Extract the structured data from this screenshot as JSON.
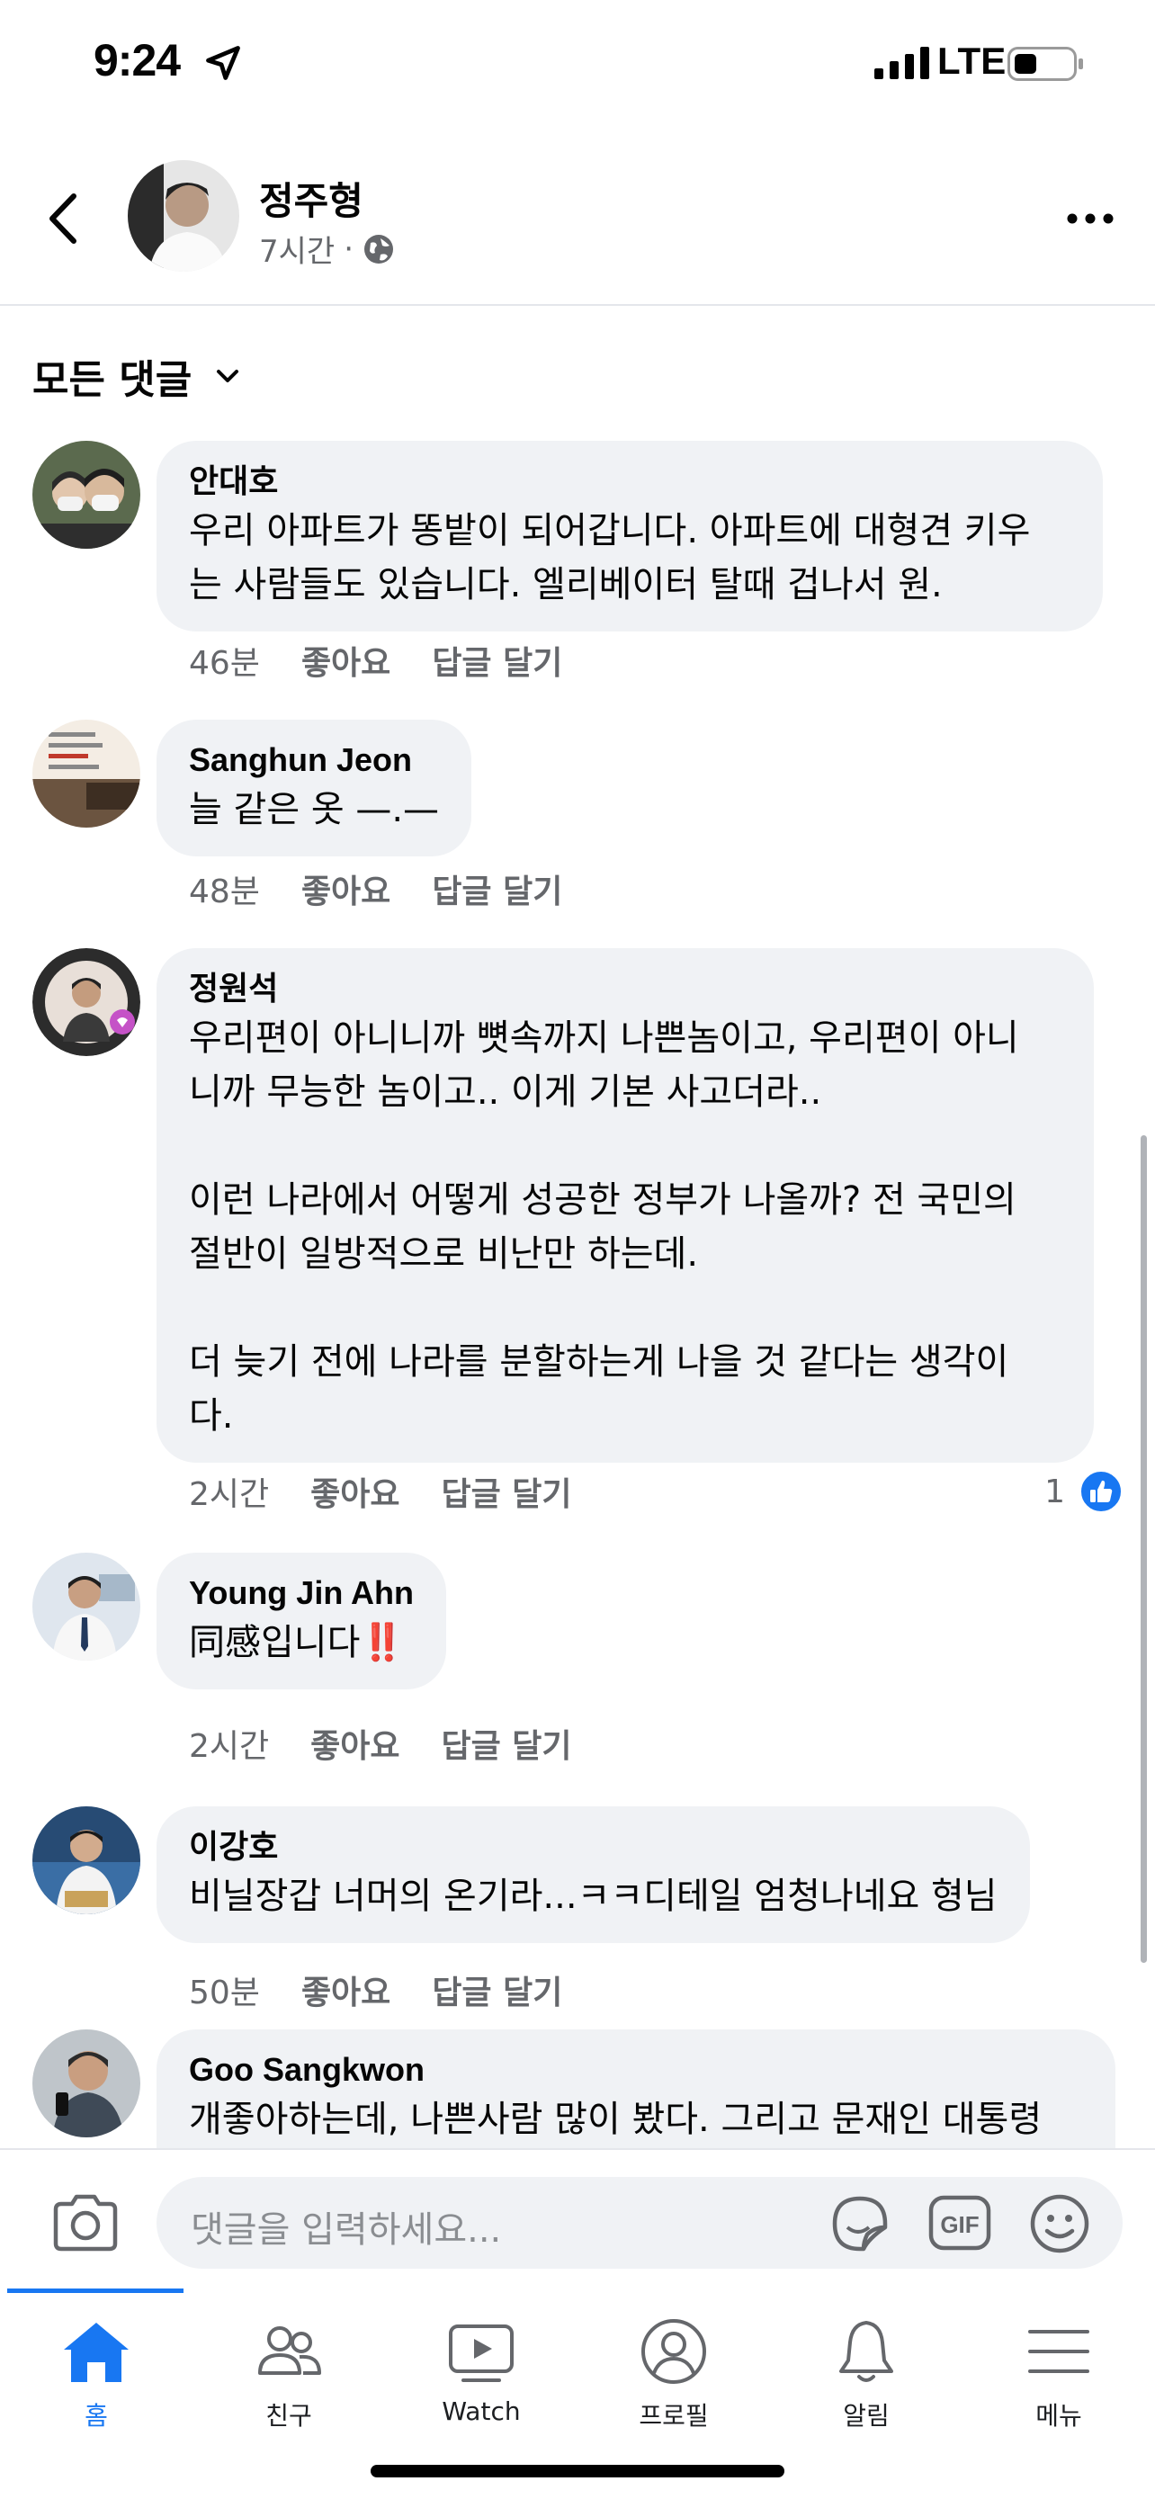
{
  "status_bar": {
    "time": "9:24",
    "network": "LTE"
  },
  "header": {
    "author": "정주형",
    "time": "7시간",
    "separator": "·",
    "privacy_icon": "globe-icon"
  },
  "filter": {
    "label": "모든 댓글"
  },
  "comments": [
    {
      "name": "안대호",
      "text": "우리 아파트가 똥밭이 되어갑니다. 아파트에 대형견 키우\n는 사람들도 있습니다. 엘리베이터 탈때 겁나서 원.",
      "time": "46분",
      "like": "좋아요",
      "reply": "답글 달기"
    },
    {
      "name": "Sanghun Jeon",
      "text": "늘 같은 옷 —.—",
      "time": "48분",
      "like": "좋아요",
      "reply": "답글 달기"
    },
    {
      "name": "정원석",
      "text": "우리편이 아니니까 뼛속까지 나쁜놈이고, 우리편이 아니\n니까 무능한 놈이고.. 이게 기본 사고더라..\n\n이런 나라에서 어떻게 성공한 정부가 나올까? 전 국민의\n절반이 일방적으로 비난만 하는데.\n\n더 늦기 전에 나라를 분할하는게 나을 것 같다는 생각이\n다.",
      "time": "2시간",
      "like": "좋아요",
      "reply": "답글 달기",
      "like_count": "1"
    },
    {
      "name": "Young Jin Ahn",
      "text": "同感입니다",
      "emoji": "‼️",
      "time": "2시간",
      "like": "좋아요",
      "reply": "답글 달기"
    },
    {
      "name": "이강호",
      "text": "비닐장갑 너머의 온기라...ㅋㅋ디테일 엄청나네요 형님",
      "time": "50분",
      "like": "좋아요",
      "reply": "답글 달기"
    },
    {
      "name": "Goo Sangkwon",
      "text": "개좋아하는데, 나쁜사람 많이 봤다. 그리고 문재인 대통령"
    }
  ],
  "composer": {
    "placeholder": "댓글을 입력하세요..."
  },
  "nav": [
    {
      "label": "홈",
      "icon": "home-icon",
      "active": true
    },
    {
      "label": "친구",
      "icon": "friends-icon"
    },
    {
      "label": "Watch",
      "icon": "watch-icon"
    },
    {
      "label": "프로필",
      "icon": "profile-icon"
    },
    {
      "label": "알림",
      "icon": "bell-icon"
    },
    {
      "label": "메뉴",
      "icon": "menu-icon"
    }
  ],
  "colors": {
    "accent": "#1877f2",
    "bubble": "#f0f2f5",
    "secondary_text": "#65676b"
  }
}
